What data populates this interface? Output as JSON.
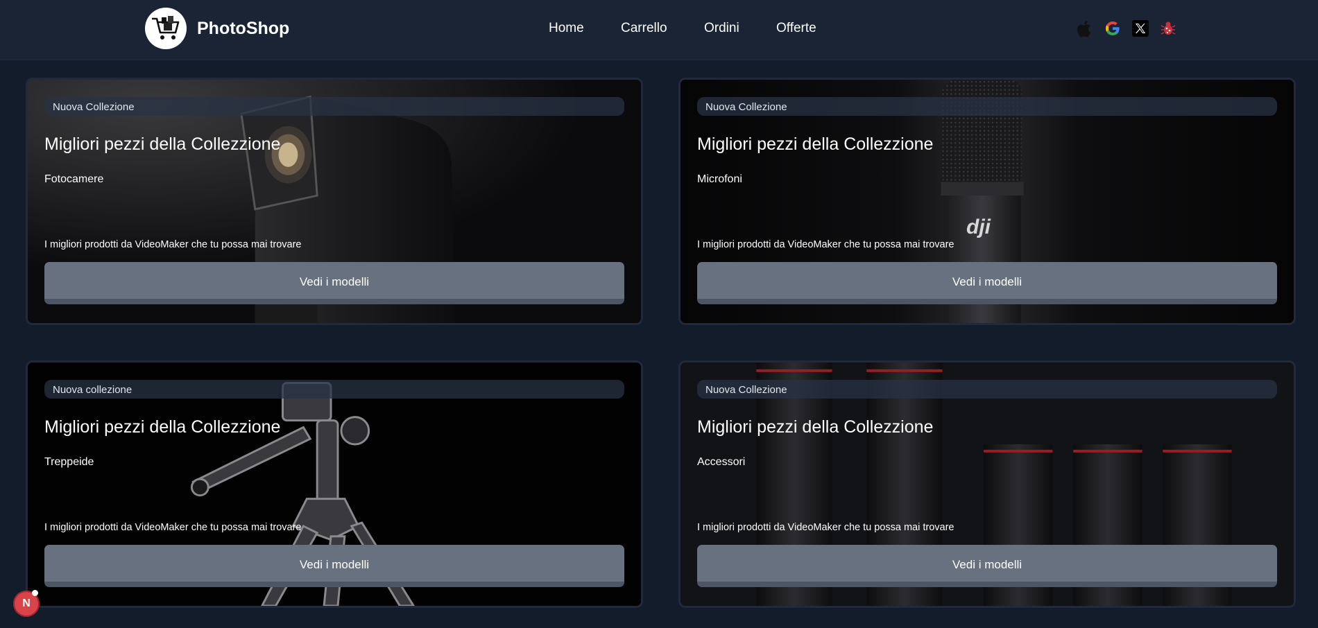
{
  "header": {
    "brand": "PhotoShop",
    "nav": [
      {
        "label": "Home"
      },
      {
        "label": "Carrello"
      },
      {
        "label": "Ordini"
      },
      {
        "label": "Offerte"
      }
    ],
    "social_icons": [
      "apple-icon",
      "google-icon",
      "x-icon",
      "bug-icon"
    ]
  },
  "cards": [
    {
      "tag": "Nuova Collezione",
      "title": "Migliori pezzi della Collezzione",
      "subtitle": "Fotocamere",
      "description": "I migliori prodotti da VideoMaker che tu possa mai trovare",
      "button": "Vedi i modelli",
      "image": "camera"
    },
    {
      "tag": "Nuova Collezione",
      "title": "Migliori pezzi della Collezzione",
      "subtitle": "Microfoni",
      "description": "I migliori prodotti da VideoMaker che tu possa mai trovare",
      "button": "Vedi i modelli",
      "image": "microphone",
      "image_text": "dji"
    },
    {
      "tag": "Nuova collezione",
      "title": "Migliori pezzi della Collezzione",
      "subtitle": "Treppeide",
      "description": "I migliori prodotti da VideoMaker che tu possa mai trovare",
      "button": "Vedi i modelli",
      "image": "tripod"
    },
    {
      "tag": "Nuova Collezione",
      "title": "Migliori pezzi della Collezzione",
      "subtitle": "Accessori",
      "description": "I migliori prodotti da VideoMaker che tu possa mai trovare",
      "button": "Vedi i modelli",
      "image": "lenses"
    }
  ],
  "fab": {
    "label": "N"
  },
  "colors": {
    "page_bg": "#131c2b",
    "header_bg": "#1b2434",
    "button_bg": "#68717f",
    "fab_bg": "#d9434a"
  }
}
